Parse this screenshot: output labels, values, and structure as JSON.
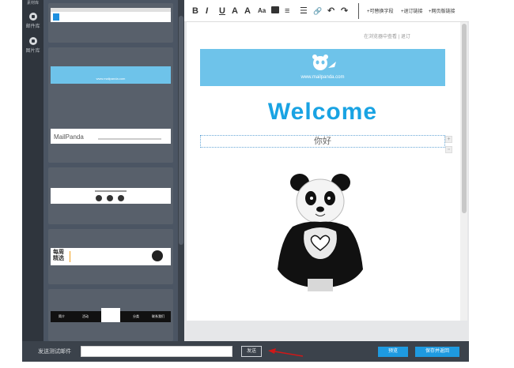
{
  "rail": {
    "top_label": "素材库",
    "items": [
      {
        "label": "邮件库",
        "icon": "mail-library-icon"
      },
      {
        "label": "图片库",
        "icon": "image-library-icon"
      }
    ]
  },
  "templates": [
    {
      "name": "template-1",
      "kind": "gray-header"
    },
    {
      "name": "template-2",
      "kind": "blue-banner",
      "url": "www.mailpanda.com"
    },
    {
      "name": "template-3",
      "kind": "mailpanda-text",
      "title": "MailPanda"
    },
    {
      "name": "template-4",
      "kind": "social-icons"
    },
    {
      "name": "template-5",
      "kind": "weekly-picks",
      "title_line1": "每周",
      "title_line2": "精选"
    },
    {
      "name": "template-6",
      "kind": "nav-bar",
      "nav": [
        "简介",
        "活动",
        "分类",
        "联系我们"
      ]
    }
  ],
  "toolbar": {
    "buttons": [
      "B",
      "I",
      "U",
      "A",
      "A",
      "Aa",
      "≡",
      "☰",
      "🔗",
      "↶",
      "↷"
    ],
    "links": [
      "+可替换字段",
      "+退订链接",
      "+网页版链接"
    ]
  },
  "canvas": {
    "top_links": "在浏览器中查看 | 退订",
    "banner_url": "www.mailpanda.com",
    "welcome": "Welcome",
    "greeting": "你好"
  },
  "bottom": {
    "test_label": "发送测试邮件",
    "test_placeholder": "",
    "send_label": "发送",
    "preview_label": "预览",
    "save_label": "保存并返回"
  },
  "colors": {
    "accent": "#19a3e3",
    "banner": "#6ec3ea",
    "panel": "#4b5563",
    "rail": "#2f353d"
  }
}
